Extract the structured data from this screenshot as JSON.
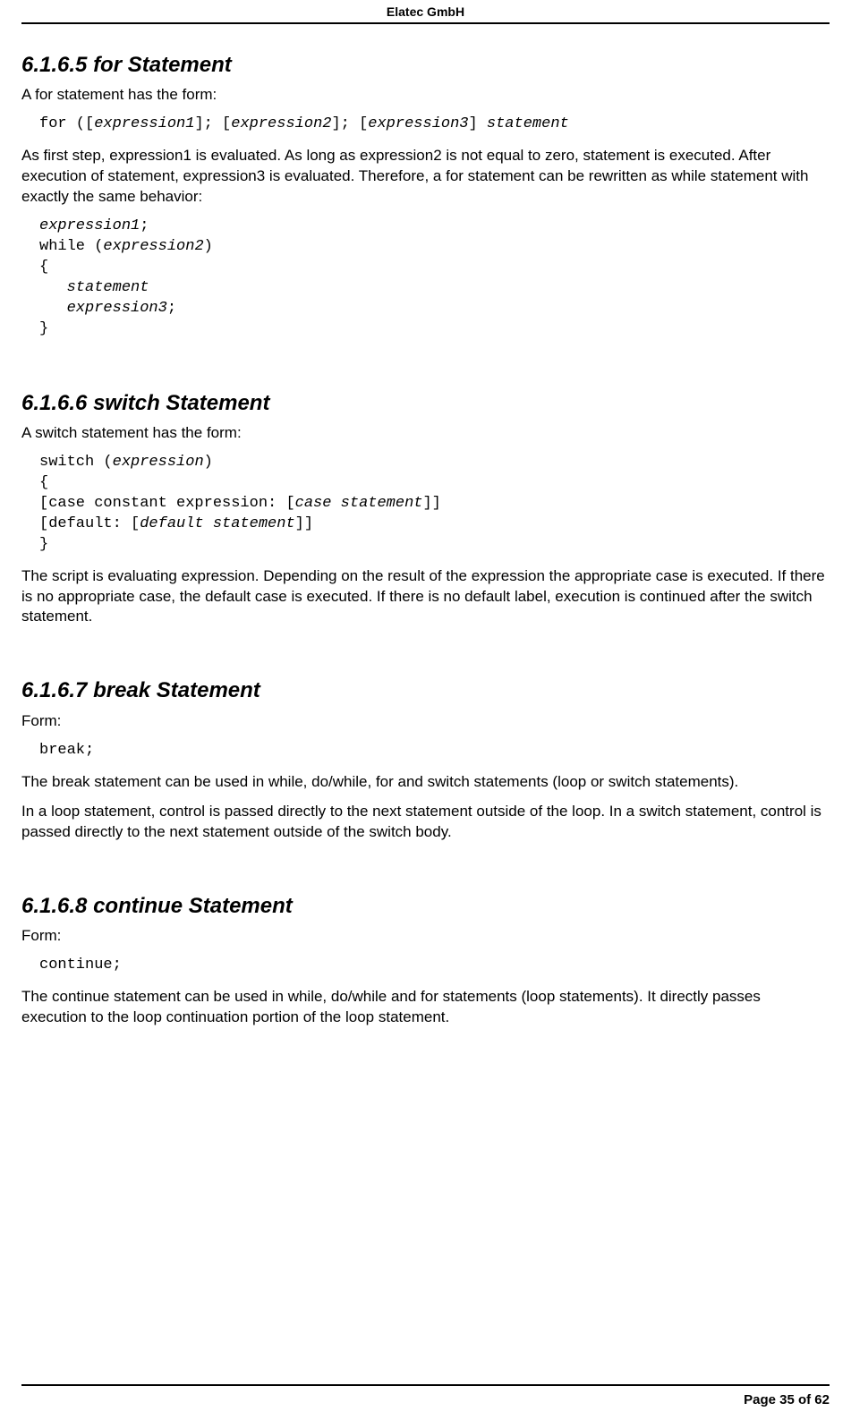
{
  "header": "Elatec GmbH",
  "footer": "Page 35 of 62",
  "sections": {
    "for": {
      "heading": "6.1.6.5  for Statement",
      "intro": "A for statement has the form:",
      "code1": "for ([<i>expression1</i>]; [<i>expression2</i>]; [<i>expression3</i>] <i>statement</i>",
      "para": "As first step, <i>expression1</i> is evaluated. As long as <i>expression2</i> is not equal to zero, <i>statement</i> is executed. After execution of <i>statement</i>, <i>expression3</i> is evaluated. Therefore, a for statement can be rewritten as while statement with exactly the same behavior:",
      "code2": "<i>expression1</i>;\nwhile (<i>expression2</i>)\n{\n   <i>statement</i>\n   <i>expression3</i>;\n}"
    },
    "switch": {
      "heading": "6.1.6.6  switch Statement",
      "intro": "A switch statement has the form:",
      "code": "switch (<i>expression</i>)\n{\n[case constant expression: [<i>case statement</i>]]\n[default: [<i>default statement</i>]]\n}",
      "para": "The script is evaluating expression. Depending on the result of the expression the appropriate case is executed. If there is no appropriate case, the default case is executed. If there is no default label, execution is continued after the switch statement."
    },
    "break": {
      "heading": "6.1.6.7  break Statement",
      "intro": "Form:",
      "code": "break;",
      "para1": "The break statement can be used in while, do/while, for and switch statements (loop or switch statements).",
      "para2": "In a loop statement, control is passed directly to the next statement outside of the loop. In a switch statement, control is passed directly to the next statement outside of the switch body."
    },
    "continue": {
      "heading": "6.1.6.8  continue Statement",
      "intro": "Form:",
      "code": "continue;",
      "para": "The continue statement can be used in while, do/while and for statements (loop statements). It directly passes execution to the loop continuation portion of the loop statement."
    }
  }
}
